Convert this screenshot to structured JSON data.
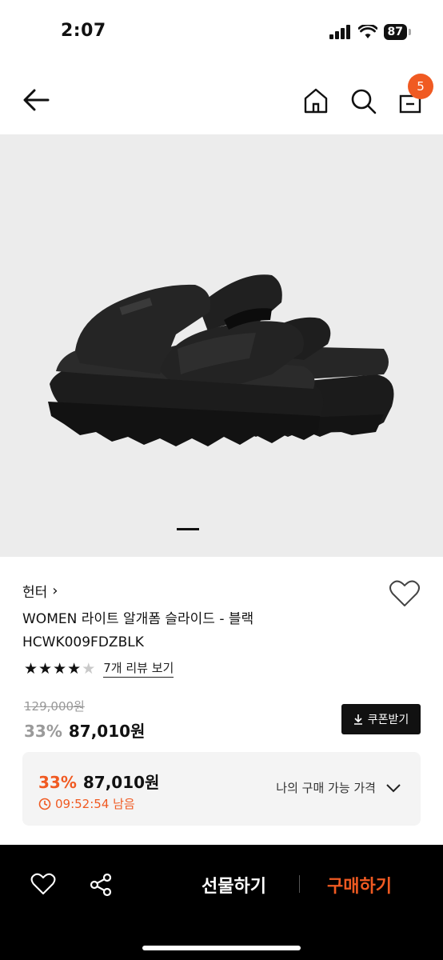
{
  "status_bar": {
    "time": "2:07",
    "battery": "87"
  },
  "nav": {
    "cart_badge": "5"
  },
  "product": {
    "brand": "헌터",
    "brand_chevron": "›",
    "title": "WOMEN 라이트 알개폼 슬라이드 - 블랙 HCWK009FDZBLK",
    "rating": 4,
    "rating_max": 5,
    "review_link": "7개 리뷰 보기",
    "original_price": "129,000원",
    "discount_rate": "33%",
    "sale_price": "87,010원",
    "coupon_label": "쿠폰받기",
    "image_count_active": 1
  },
  "my_price": {
    "discount_rate": "33%",
    "price": "87,010원",
    "timer": "09:52:54 남음",
    "label": "나의 구매 가능 가격"
  },
  "bottom_bar": {
    "gift_label": "선물하기",
    "buy_label": "구매하기"
  },
  "colors": {
    "accent": "#f05a22",
    "dark": "#111111",
    "image_bg": "#ececec",
    "box_bg": "#f4f4f4"
  },
  "icons": [
    "back-arrow-icon",
    "home-icon",
    "search-icon",
    "cart-icon",
    "heart-icon",
    "share-icon",
    "download-icon",
    "clock-icon",
    "chevron-down-icon"
  ]
}
